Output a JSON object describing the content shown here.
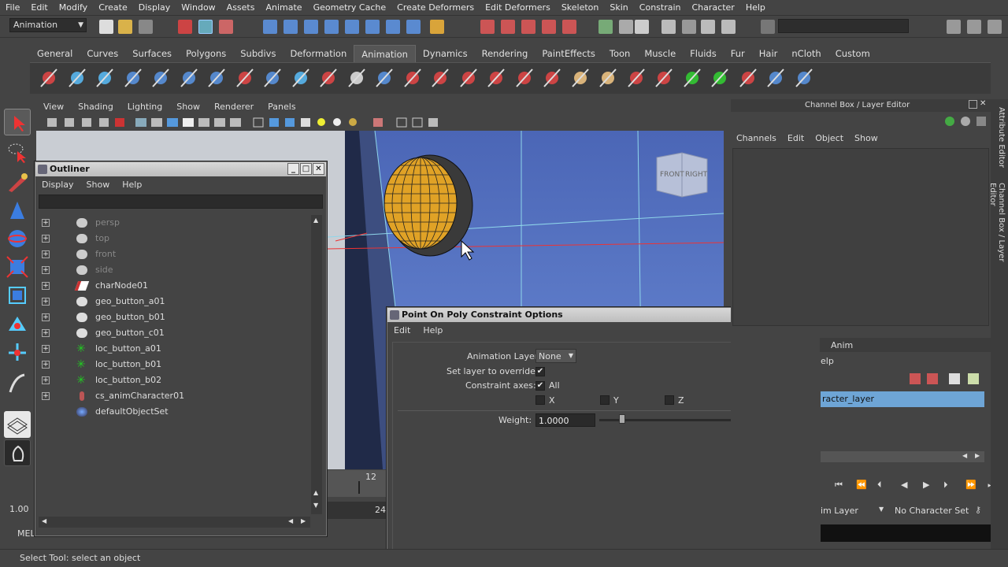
{
  "menubar": [
    "File",
    "Edit",
    "Modify",
    "Create",
    "Display",
    "Window",
    "Assets",
    "Animate",
    "Geometry Cache",
    "Create Deformers",
    "Edit Deformers",
    "Skeleton",
    "Skin",
    "Constrain",
    "Character",
    "Help"
  ],
  "mode_selector": "Animation",
  "shelf_tabs": [
    "General",
    "Curves",
    "Surfaces",
    "Polygons",
    "Subdivs",
    "Deformation",
    "Animation",
    "Dynamics",
    "Rendering",
    "PaintEffects",
    "Toon",
    "Muscle",
    "Fluids",
    "Fur",
    "Hair",
    "nCloth",
    "Custom"
  ],
  "active_shelf_tab": "Animation",
  "viewport": {
    "menus": [
      "View",
      "Shading",
      "Lighting",
      "Show",
      "Renderer",
      "Panels"
    ],
    "viewcube": {
      "front": "FRONT",
      "right": "RIGHT"
    }
  },
  "outliner": {
    "title": "Outliner",
    "menus": [
      "Display",
      "Show",
      "Help"
    ],
    "items": [
      {
        "label": "persp",
        "icon": "camera-icon",
        "dim": true
      },
      {
        "label": "top",
        "icon": "camera-icon",
        "dim": true
      },
      {
        "label": "front",
        "icon": "camera-icon",
        "dim": true
      },
      {
        "label": "side",
        "icon": "camera-icon",
        "dim": true
      },
      {
        "label": "charNode01",
        "icon": "character-node-icon",
        "dim": false
      },
      {
        "label": "geo_button_a01",
        "icon": "transform-icon",
        "dim": false
      },
      {
        "label": "geo_button_b01",
        "icon": "transform-icon",
        "dim": false
      },
      {
        "label": "geo_button_c01",
        "icon": "transform-icon",
        "dim": false
      },
      {
        "label": "loc_button_a01",
        "icon": "locator-icon",
        "dim": false
      },
      {
        "label": "loc_button_b01",
        "icon": "locator-icon",
        "dim": false
      },
      {
        "label": "loc_button_b02",
        "icon": "locator-icon",
        "dim": false
      },
      {
        "label": "cs_animCharacter01",
        "icon": "character-set-icon",
        "dim": false
      },
      {
        "label": "defaultObjectSet",
        "icon": "object-set-icon",
        "dim": false
      }
    ]
  },
  "poc_dialog": {
    "title": "Point On Poly Constraint Options",
    "menus": [
      "Edit",
      "Help"
    ],
    "animation_layer_label": "Animation Layer",
    "animation_layer_value": "None",
    "override_label": "Set layer to override:",
    "axes_label": "Constraint axes:",
    "axes_all": "All",
    "axes": [
      "X",
      "Y",
      "Z"
    ],
    "weight_label": "Weight:",
    "weight_value": "1.0000"
  },
  "channel_box": {
    "title": "Channel Box / Layer Editor",
    "menus": [
      "Channels",
      "Edit",
      "Object",
      "Show"
    ],
    "anim_tab": "Anim",
    "help_menu": "elp",
    "layer_name": "racter_layer"
  },
  "right_strip": {
    "attribute_editor": "Attribute Editor",
    "channel_box": "Channel Box / Layer Editor"
  },
  "timeline": {
    "tick_12": "12",
    "end_24": "24",
    "start_value": "1.00",
    "mel": "MEL"
  },
  "bottom": {
    "anim_layer": "im Layer",
    "character_set": "No Character Set"
  },
  "helpline": "Select Tool: select an object"
}
